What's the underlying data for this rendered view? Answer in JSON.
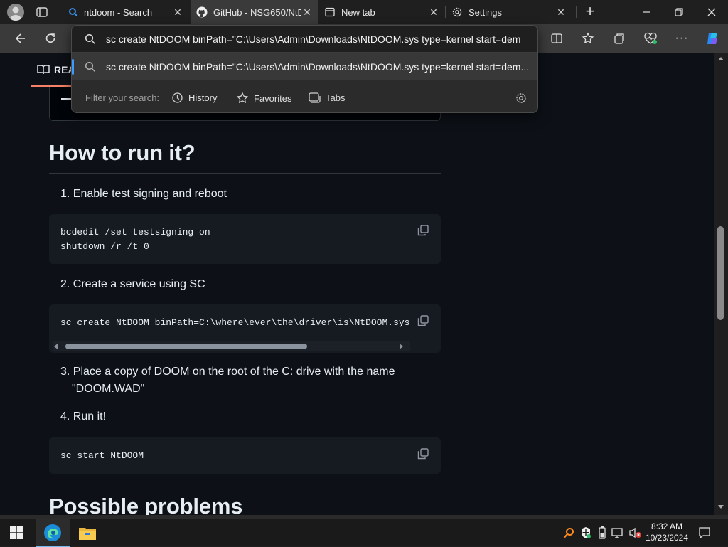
{
  "browser": {
    "tabs": [
      {
        "title": "ntdoom - Search",
        "icon": "bing-search-icon",
        "active": false
      },
      {
        "title": "GitHub - NSG650/NtD",
        "icon": "github-icon",
        "active": true
      },
      {
        "title": "New tab",
        "icon": "new-tab-icon",
        "active": false
      },
      {
        "title": "Settings",
        "icon": "gear-icon",
        "active": false
      }
    ],
    "new_tab_symbol": "+",
    "address_text": "sc create NtDOOM binPath=\"C:\\Users\\Admin\\Downloads\\NtDOOM.sys type=kernel start=dem"
  },
  "omnibox": {
    "suggestion": "sc create NtDOOM binPath=\"C:\\Users\\Admin\\Downloads\\NtDOOM.sys type=kernel start=dem...",
    "filter_label": "Filter your search:",
    "filters": [
      "History",
      "Favorites",
      "Tabs"
    ]
  },
  "readme": {
    "tab_label": "REA",
    "heading_run": "How to run it?",
    "steps": [
      {
        "num": "1.",
        "text": "Enable test signing and reboot"
      },
      {
        "num": "2.",
        "text": "Create a service using SC"
      },
      {
        "num": "3.",
        "text": "Place a copy of DOOM on the root of the C: drive with the name",
        "text2": "\"DOOM.WAD\""
      },
      {
        "num": "4.",
        "text": "Run it!"
      }
    ],
    "code1": "bcdedit /set testsigning on\nshutdown /r /t 0",
    "code2": "sc create NtDOOM binPath=C:\\where\\ever\\the\\driver\\is\\NtDOOM.sys ty",
    "code3": "sc start NtDOOM",
    "heading_problems": "Possible problems"
  },
  "taskbar": {
    "time": "8:32 AM",
    "date": "10/23/2024"
  },
  "colors": {
    "page_bg": "#0d1117",
    "code_bg": "#161b22",
    "browser_chrome": "#3a3a3a",
    "accent_orange": "#f78166"
  }
}
